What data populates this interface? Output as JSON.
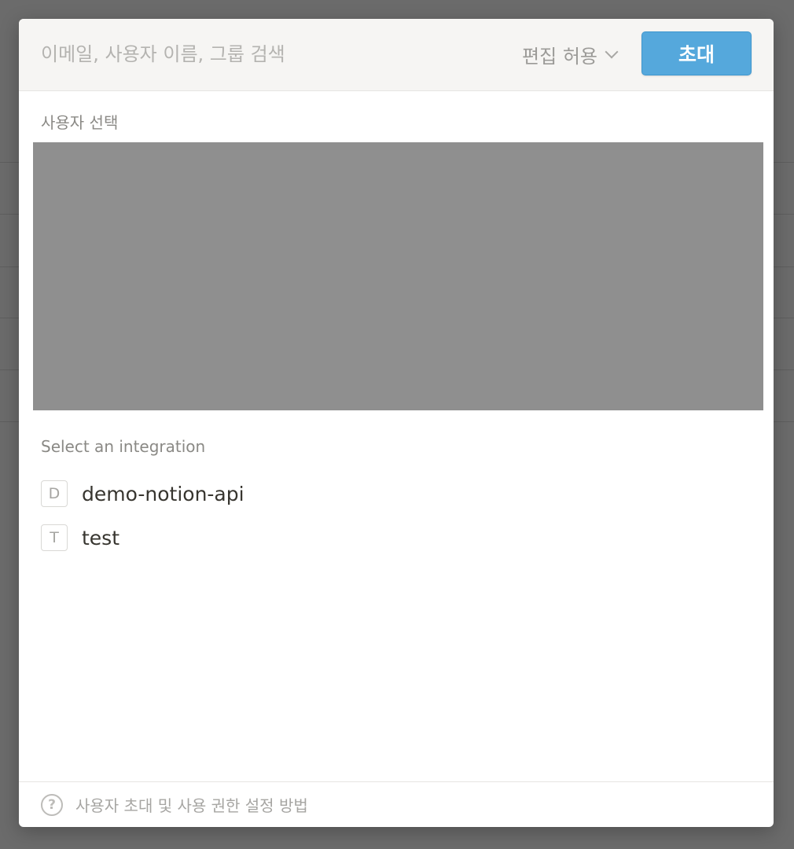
{
  "header": {
    "search_placeholder": "이메일, 사용자 이름, 그룹 검색",
    "permission_label": "편집 허용",
    "invite_label": "초대"
  },
  "users": {
    "section_label": "사용자 선택"
  },
  "integrations": {
    "section_label": "Select an integration",
    "items": [
      {
        "badge": "D",
        "name": "demo-notion-api"
      },
      {
        "badge": "T",
        "name": "test"
      }
    ]
  },
  "footer": {
    "help_icon": "question-circle-icon",
    "help_text": "사용자 초대 및 사용 권한 설정 방법"
  },
  "colors": {
    "invite_button": "#55a8dc",
    "header_bg": "#f6f5f3",
    "overlay": "#6b6b6b"
  }
}
